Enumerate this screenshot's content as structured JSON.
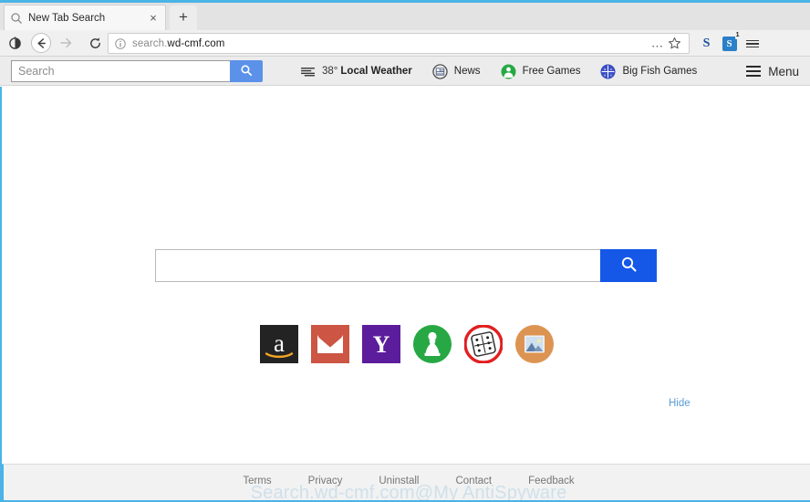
{
  "browser": {
    "tab": {
      "title": "New Tab Search",
      "favicon": "search-icon",
      "close_label": "×"
    },
    "new_tab_button_label": "+",
    "nav": {
      "back_label": "←",
      "forward_label": "→",
      "reload_label": "↻",
      "tracking_label": "shield-icon"
    },
    "url": {
      "subdomain": "search.",
      "host": "wd-cmf.com",
      "full": "search.wd-cmf.com",
      "info_icon": "info-icon"
    },
    "url_actions": {
      "more_label": "⋯",
      "bookmark_label": "star-icon"
    },
    "right_icons": [
      {
        "name": "skype-icon",
        "label": "S"
      },
      {
        "name": "skype-notification-icon",
        "label": "S",
        "badge": "1"
      },
      {
        "name": "app-menu-icon",
        "label": ""
      }
    ]
  },
  "toolbar": {
    "search": {
      "placeholder": "Search",
      "value": "",
      "button_icon": "search-icon"
    },
    "links": [
      {
        "icon": "weather-icon",
        "temp": "38°",
        "label": "Local Weather"
      },
      {
        "icon": "news-icon",
        "label": "News"
      },
      {
        "icon": "free-games-icon",
        "label": "Free Games"
      },
      {
        "icon": "big-fish-games-icon",
        "label": "Big Fish Games"
      }
    ],
    "menu_label": "Menu"
  },
  "main": {
    "search": {
      "placeholder": "",
      "value": "",
      "button_icon": "search-icon"
    },
    "hide_label": "Hide",
    "shortcuts": [
      {
        "name": "amazon-shortcut",
        "label": "Amazon"
      },
      {
        "name": "gmail-shortcut",
        "label": "Gmail"
      },
      {
        "name": "yahoo-shortcut",
        "label": "Yahoo"
      },
      {
        "name": "free-games-shortcut",
        "label": "Free Games"
      },
      {
        "name": "dice-games-shortcut",
        "label": "Games"
      },
      {
        "name": "photos-shortcut",
        "label": "Photos"
      }
    ]
  },
  "footer": {
    "links": [
      {
        "label": "Terms"
      },
      {
        "label": "Privacy"
      },
      {
        "label": "Uninstall"
      },
      {
        "label": "Contact"
      },
      {
        "label": "Feedback"
      }
    ],
    "watermark": "Search.wd-cmf.com@My AntiSpyware"
  },
  "colors": {
    "accent_blue": "#4ab3e8",
    "toolbar_search_blue": "#5b91e8",
    "main_search_blue": "#1558e8",
    "hide_link_blue": "#5b9bd5",
    "watermark_blue": "#cfe0ea"
  }
}
